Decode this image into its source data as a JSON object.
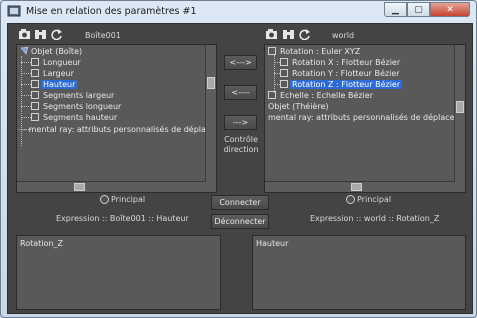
{
  "window": {
    "title": "Mise en relation des paramètres #1",
    "buttons": [
      "minimize-icon",
      "maximize-icon",
      "close-icon"
    ]
  },
  "left_panel": {
    "object_label": "Boîte001",
    "toolbar_icons": [
      "select-object-icon",
      "find-icon",
      "refresh-icon"
    ],
    "tree": [
      {
        "text": "Objet (Boîte)",
        "icon": "object-icon",
        "selected": false
      },
      {
        "text": "Longueur",
        "icon": "param-icon",
        "selected": false
      },
      {
        "text": "Largeur",
        "icon": "param-icon",
        "selected": false
      },
      {
        "text": "Hauteur",
        "icon": "param-icon",
        "selected": true
      },
      {
        "text": "Segments largeur",
        "icon": "param-icon",
        "selected": false
      },
      {
        "text": "Segments longueur",
        "icon": "param-icon",
        "selected": false
      },
      {
        "text": "Segments hauteur",
        "icon": "param-icon",
        "selected": false
      },
      {
        "text": "mental ray: attributs personnalisés de déplacement",
        "icon": "none",
        "selected": false
      }
    ],
    "radio_label": "Principal",
    "expression": "Expression :: Boîte001 :: Hauteur",
    "expression_text": "Rotation_Z"
  },
  "right_panel": {
    "object_label": "world",
    "toolbar_icons": [
      "select-object-icon",
      "find-icon",
      "refresh-icon"
    ],
    "tree": [
      {
        "text": "Rotation : Euler XYZ",
        "icon": "controller-icon",
        "selected": false
      },
      {
        "text": "Rotation X : Flotteur Bézier",
        "icon": "controller-icon",
        "selected": false
      },
      {
        "text": "Rotation Y : Flotteur Bézier",
        "icon": "controller-icon",
        "selected": false
      },
      {
        "text": "Rotation Z : Flotteur Bézier",
        "icon": "controller-icon",
        "selected": true
      },
      {
        "text": "Echelle : Echelle Bézier",
        "icon": "controller-icon",
        "selected": false
      },
      {
        "text": "Objet (Théière)",
        "icon": "none",
        "selected": false
      },
      {
        "text": "mental ray: attributs personnalisés de déplacement",
        "icon": "none",
        "selected": false
      }
    ],
    "radio_label": "Principal",
    "expression": "Expression :: world :: Rotation_Z",
    "expression_text": "Hauteur"
  },
  "center": {
    "arrow_right": "<--->",
    "arrow_left": "<----",
    "arrow_both": "--->",
    "direction_label": "Contrôle direction",
    "connect_label": "Connecter",
    "disconnect_label": "Déconnecter"
  },
  "colors": {
    "panel_bg": "#444444",
    "list_bg": "#595959",
    "selection": "#2c6ad6",
    "text": "#e8e8e8"
  }
}
